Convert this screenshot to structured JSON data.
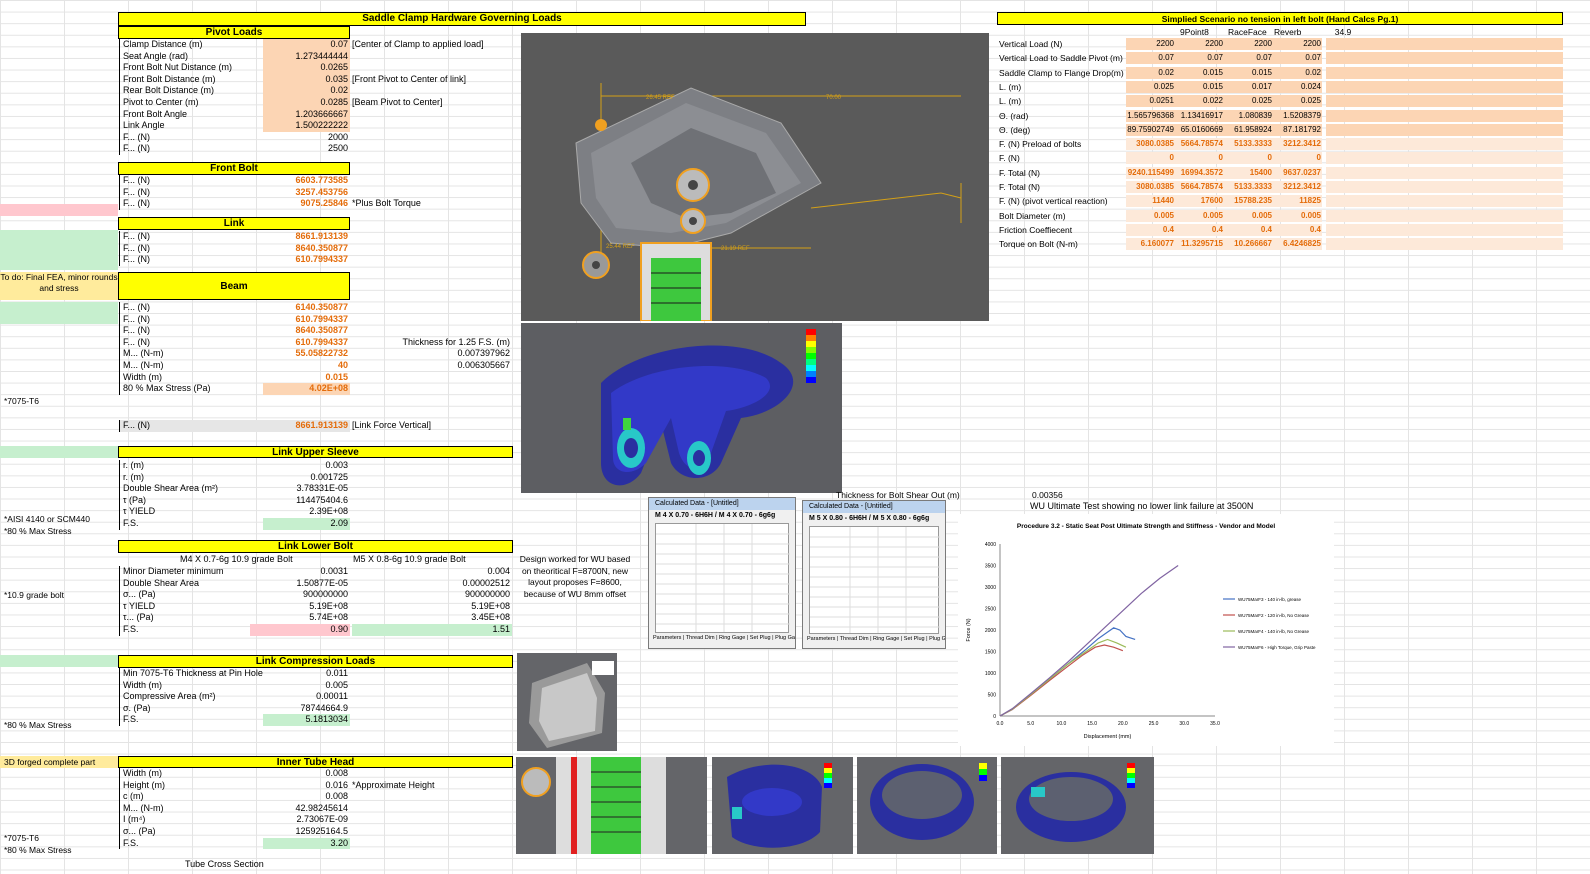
{
  "main_title": "Saddle Clamp Hardware Governing Loads",
  "pivot": {
    "header": "Pivot Loads",
    "rows": [
      {
        "label": "Clamp Distance (m)",
        "value": "0.07",
        "note": "[Center of Clamp to applied load]",
        "input": true
      },
      {
        "label": "Seat Angle (rad)",
        "value": "1.273444444",
        "note": "",
        "input": true
      },
      {
        "label": "Front Bolt Nut Distance (m)",
        "value": "0.0265",
        "note": "",
        "input": true
      },
      {
        "label": "Front Bolt Distance (m)",
        "value": "0.035",
        "note": "[Front Pivot to Center of link]",
        "input": true
      },
      {
        "label": "Rear Bolt Distance (m)",
        "value": "0.02",
        "note": "",
        "input": true
      },
      {
        "label": "Pivot to Center (m)",
        "value": "0.0285",
        "note": "[Beam Pivot to Center]",
        "input": true
      },
      {
        "label": "Front Bolt Angle",
        "value": "1.203666667",
        "note": "",
        "input": true
      },
      {
        "label": "Link Angle",
        "value": "1.500222222",
        "note": "",
        "input": true
      },
      {
        "label": "F... (N)",
        "value": "2000",
        "note": "",
        "input": false
      },
      {
        "label": "F... (N)",
        "value": "2500",
        "note": "",
        "input": false
      }
    ]
  },
  "front_bolt": {
    "header": "Front Bolt",
    "rows": [
      {
        "label": "F... (N)",
        "value": "6603.773585"
      },
      {
        "label": "F... (N)",
        "value": "3257.453756"
      },
      {
        "label": "F... (N)",
        "value": "9075.25846",
        "note": "*Plus Bolt Torque"
      }
    ]
  },
  "link": {
    "header": "Link",
    "rows": [
      {
        "label": "F... (N)",
        "value": "8661.913139"
      },
      {
        "label": "F... (N)",
        "value": "8640.350877"
      },
      {
        "label": "F... (N)",
        "value": "610.7994337"
      }
    ]
  },
  "beam": {
    "header": "Beam",
    "left_note": "To do: Final FEA, minor rounds and stress",
    "rows": [
      {
        "label": "F... (N)",
        "value": "6140.350877",
        "note": ""
      },
      {
        "label": "F... (N)",
        "value": "610.7994337",
        "note": ""
      },
      {
        "label": "F... (N)",
        "value": "8640.350877",
        "note": ""
      },
      {
        "label": "F... (N)",
        "value": "610.7994337",
        "note": "Thickness for 1.25 F.S. (m)"
      },
      {
        "label": "M... (N-m)",
        "value": "55.05822732",
        "note": "0.007397962"
      },
      {
        "label": "M... (N-m)",
        "value": "40",
        "note": "0.006305667"
      },
      {
        "label": "Width (m)",
        "value": "0.015",
        "note": ""
      },
      {
        "label": "80 % Max Stress (Pa)",
        "value": "4.02E+08",
        "note": ""
      }
    ],
    "material": "*7075-T6",
    "total_label": "F... (N)",
    "total_value": "8661.913139",
    "total_note": "[Link Force Vertical]"
  },
  "upper_sleeve": {
    "header": "Link Upper Sleeve",
    "rows": [
      {
        "label": "r. (m)",
        "value": "0.003"
      },
      {
        "label": "r. (m)",
        "value": "0.001725"
      },
      {
        "label": "Double Shear Area (m²)",
        "value": "3.78331E-05"
      },
      {
        "label": "τ (Pa)",
        "value": "114475404.6"
      },
      {
        "label": "τ YIELD",
        "value": "2.39E+08"
      },
      {
        "label": "F.S.",
        "value": "2.09"
      }
    ],
    "tag1": "*AISI 4140 or SCM440",
    "tag2": "*80 % Max Stress"
  },
  "lower_bolt": {
    "header": "Link Lower Bolt",
    "col1": "M4 X 0.7-6g 10.9 grade Bolt",
    "col2": "M5 X 0.8-6g 10.9 grade Bolt",
    "rows": [
      {
        "label": "Minor Diameter minimum",
        "v1": "0.0031",
        "v2": "0.004"
      },
      {
        "label": "Double Shear Area",
        "v1": "1.50877E-05",
        "v2": "0.00002512"
      },
      {
        "label": "σ... (Pa)",
        "v1": "900000000",
        "v2": "900000000"
      },
      {
        "label": "τ YIELD",
        "v1": "5.19E+08",
        "v2": "5.19E+08"
      },
      {
        "label": "τ... (Pa)",
        "v1": "5.74E+08",
        "v2": "3.45E+08"
      },
      {
        "label": "F.S.",
        "v1": "0.90",
        "v2": "1.51"
      }
    ],
    "tag": "*10.9 grade bolt",
    "design_note": "Design worked for WU based on theoritical F=8700N, new layout proposes F=8600, because of WU 8mm offset"
  },
  "compression": {
    "header": "Link Compression Loads",
    "rows": [
      {
        "label": "Min 7075-T6 Thickness at Pin Hole",
        "value": "0.011"
      },
      {
        "label": "Width (m)",
        "value": "0.005"
      },
      {
        "label": "Compressive Area (m²)",
        "value": "0.00011"
      },
      {
        "label": "σ. (Pa)",
        "value": "78744664.9"
      },
      {
        "label": "F.S.",
        "value": "5.1813034"
      }
    ],
    "tag": "*80 % Max Stress"
  },
  "inner_tube": {
    "header": "Inner Tube Head",
    "rows": [
      {
        "label": "Width (m)",
        "value": "0.008",
        "note": ""
      },
      {
        "label": "Height (m)",
        "value": "0.016",
        "note": "*Approximate Height"
      },
      {
        "label": "c (m)",
        "value": "0.008",
        "note": ""
      },
      {
        "label": "M... (N-m)",
        "value": "42.98245614",
        "note": ""
      },
      {
        "label": "I (m⁴)",
        "value": "2.73067E-09",
        "note": ""
      },
      {
        "label": "σ... (Pa)",
        "value": "125925164.5",
        "note": ""
      },
      {
        "label": "F.S.",
        "value": "3.20",
        "note": ""
      }
    ],
    "tag_top": "3D forged complete part",
    "tag1": "*7075-T6",
    "tag2": "*80 % Max Stress",
    "footer_cut": "Tube Cross Section"
  },
  "bolt_shear": {
    "label": "Thickness for Bolt Shear Out (m)",
    "value": "0.00356"
  },
  "wu_note": "WU Ultimate Test showing no lower link failure at 3500N",
  "simplified": {
    "title": "Simplied Scenario no tension in left bolt (Hand Calcs Pg.1)",
    "cols": [
      "9Point8",
      "RaceFace",
      "Reverb",
      "34.9"
    ],
    "rows": [
      {
        "label": "Vertical Load (N)",
        "vals": [
          "2200",
          "2200",
          "2200",
          "2200"
        ],
        "style": "input"
      },
      {
        "label": "Vertical Load to Saddle Pivot (m)",
        "vals": [
          "0.07",
          "0.07",
          "0.07",
          "0.07"
        ],
        "style": "input"
      },
      {
        "label": "Saddle Clamp to Flange Drop(m)",
        "vals": [
          "0.02",
          "0.015",
          "0.015",
          "0.02"
        ],
        "style": "input"
      },
      {
        "label": "L. (m)",
        "vals": [
          "0.025",
          "0.015",
          "0.017",
          "0.024"
        ],
        "style": "input"
      },
      {
        "label": "L. (m)",
        "vals": [
          "0.0251",
          "0.022",
          "0.025",
          "0.025"
        ],
        "style": "input"
      },
      {
        "label": "Θ. (rad)",
        "vals": [
          "1.565796368",
          "1.13416917",
          "1.080839",
          "1.5208379"
        ],
        "style": "input"
      },
      {
        "label": "Θ. (deg)",
        "vals": [
          "89.75902749",
          "65.0160669",
          "61.958924",
          "87.181792"
        ],
        "style": "input"
      },
      {
        "label": "F. (N) Preload of bolts",
        "vals": [
          "3080.0385",
          "5664.78574",
          "5133.3333",
          "3212.3412"
        ],
        "style": "orange"
      },
      {
        "label": "F. (N)",
        "vals": [
          "0",
          "0",
          "0",
          "0"
        ],
        "style": "orange"
      },
      {
        "label": "F. Total (N)",
        "vals": [
          "9240.115499",
          "16994.3572",
          "15400",
          "9637.0237"
        ],
        "style": "orange"
      },
      {
        "label": "F. Total (N)",
        "vals": [
          "3080.0385",
          "5664.78574",
          "5133.3333",
          "3212.3412"
        ],
        "style": "orange"
      },
      {
        "label": "F. (N) (pivot vertical reaction)",
        "vals": [
          "11440",
          "17600",
          "15788.235",
          "11825"
        ],
        "style": "orange"
      },
      {
        "label": "Bolt Diameter (m)",
        "vals": [
          "0.005",
          "0.005",
          "0.005",
          "0.005"
        ],
        "style": "orange"
      },
      {
        "label": "Friction Coeffiecent",
        "vals": [
          "0.4",
          "0.4",
          "0.4",
          "0.4"
        ],
        "style": "orange"
      },
      {
        "label": "Torque on Bolt (N-m)",
        "vals": [
          "6.160077",
          "11.3295715",
          "10.266667",
          "6.4246825"
        ],
        "style": "orange"
      }
    ]
  },
  "cad": {
    "dim1": "26.45 REF",
    "dim2": "70.00",
    "dim3": "21.19 REF",
    "dim4": "25.44 REF"
  },
  "dialogs": [
    {
      "title": "Calculated Data - [Untitled]",
      "head": "M 4 X 0.70 - 6H6H / M 4 X 0.70 - 6g6g",
      "tabs": "Parameters | Thread Dim | Ring Gage | Set Plug | Plug Gage | Gagemaker"
    },
    {
      "title": "Calculated Data - [Untitled]",
      "head": "M 5 X 0.80 - 6H6H / M 5 X 0.80 - 6g6g",
      "tabs": "Parameters | Thread Dim | Ring Gage | Set Plug | Plug Gage | Gagemaker"
    }
  ],
  "chart_data": {
    "type": "line",
    "title": "Procedure 3.2 - Static Seat Post Ultimate Strength and Stiffness - Vendor and Model",
    "xlabel": "Displacement (mm)",
    "ylabel": "Force (N)",
    "xlim": [
      0,
      35
    ],
    "ylim": [
      0,
      4000
    ],
    "xticks": [
      "0.0",
      "5.0",
      "10.0",
      "15.0",
      "20.0",
      "25.0",
      "30.0",
      "35.0"
    ],
    "yticks": [
      "0",
      "500",
      "1000",
      "1500",
      "2000",
      "2500",
      "3000",
      "3500",
      "4000"
    ],
    "legend_position": "right",
    "series": [
      {
        "name": "WU75MarF3 - 140 in-lb, grease",
        "color": "#4472c4",
        "x": [
          0,
          2,
          5,
          8,
          11,
          14,
          16,
          17.5,
          18.5,
          19.5,
          20.5,
          22
        ],
        "y": [
          0,
          150,
          500,
          850,
          1200,
          1550,
          1800,
          1950,
          2050,
          2000,
          1850,
          1780
        ]
      },
      {
        "name": "WU75MarF2 - 120 in-lb, No Grease",
        "color": "#c0504d",
        "x": [
          0,
          2,
          5,
          8,
          11,
          13.5,
          15.5,
          17,
          18.5,
          20
        ],
        "y": [
          0,
          150,
          480,
          820,
          1150,
          1420,
          1600,
          1650,
          1600,
          1520
        ]
      },
      {
        "name": "WU75MarF4 - 140 in-lb, No Grease",
        "color": "#9bbb59",
        "x": [
          0,
          2,
          5,
          8,
          11,
          14,
          16,
          17.5,
          19,
          20.5
        ],
        "y": [
          0,
          160,
          500,
          850,
          1200,
          1500,
          1700,
          1780,
          1700,
          1600
        ]
      },
      {
        "name": "WU75MarF6 - High Torque, Grip Paste",
        "color": "#8064a2",
        "x": [
          0,
          2,
          5,
          8,
          11,
          14,
          17,
          20,
          23,
          26,
          29
        ],
        "y": [
          0,
          170,
          520,
          880,
          1250,
          1650,
          2050,
          2450,
          2850,
          3200,
          3500
        ]
      }
    ]
  }
}
